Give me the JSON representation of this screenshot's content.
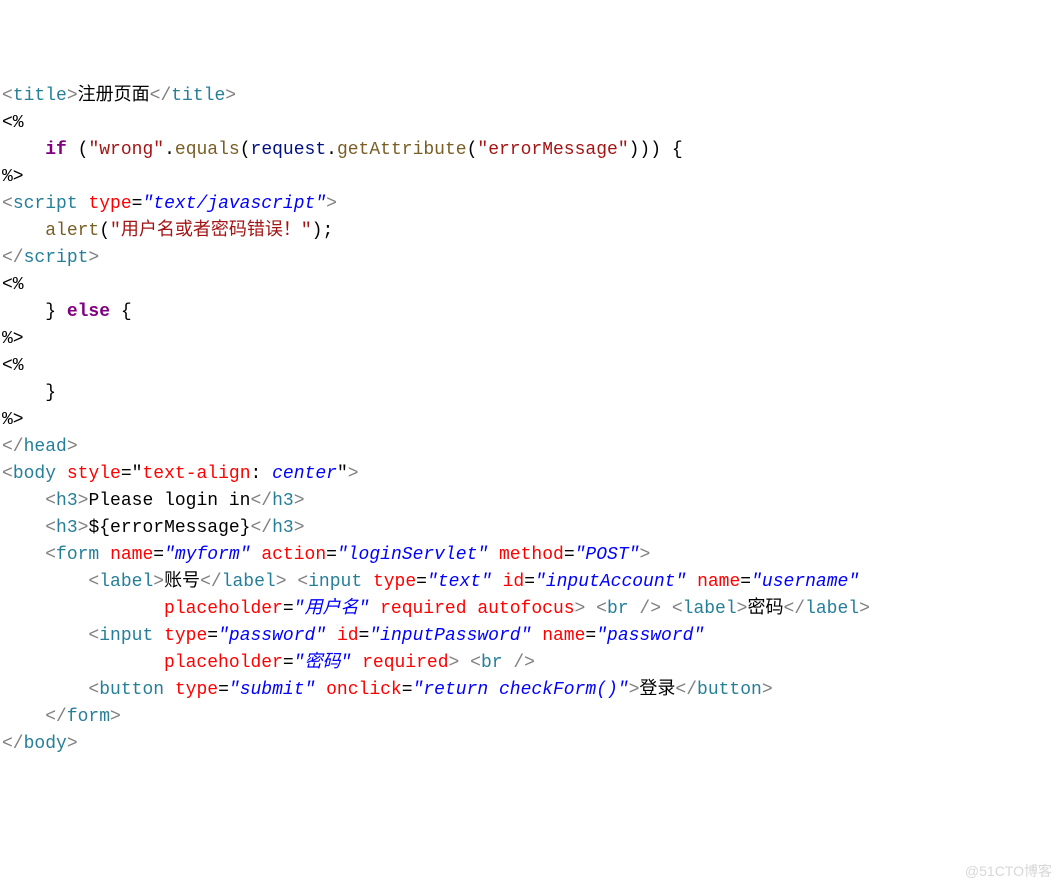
{
  "lines": {
    "l1": {
      "open": "<",
      "tag": "title",
      "gt": ">",
      "text": "注册页面",
      "lt2": "</",
      "tag2": "title",
      "gt2": ">"
    },
    "l2": {
      "open": "<%"
    },
    "l3": {
      "indent": "    ",
      "kw": "if",
      "sp": " ",
      "p": "(",
      "s": "\"wrong\"",
      "dot": ".",
      "m": "equals",
      "op": "(",
      "v": "request",
      "dot2": ".",
      "m2": "getAttribute",
      "op2": "(",
      "s2": "\"errorMessage\"",
      "cp": "))) {"
    },
    "l4": {
      "close": "%>"
    },
    "l5": {
      "lt": "<",
      "tag": "script",
      "sp": " ",
      "attr": "type",
      "eq": "=",
      "val": "\"text/javascript\"",
      "gt": ">"
    },
    "l6": {
      "indent": "    ",
      "fn": "alert",
      "p": "(",
      "s": "\"用户名或者密码错误！\"",
      "cp": ");"
    },
    "l7": {
      "lt": "</",
      "tag": "script",
      "gt": ">"
    },
    "l8": {
      "open": "<%"
    },
    "l9": {
      "indent": "    } ",
      "kw": "else",
      "rest": " {"
    },
    "l10": {
      "close": "%>"
    },
    "l11": {
      "open": "<%"
    },
    "l12": {
      "indent": "    }"
    },
    "l13": {
      "close": "%>"
    },
    "l14": {
      "lt": "</",
      "tag": "head",
      "gt": ">"
    },
    "l15": {
      "lt": "<",
      "tag": "body",
      "sp": " ",
      "attr": "style",
      "eq": "=",
      "q": "\"",
      "prop": "text-align",
      "col": ": ",
      "val": "center",
      "q2": "\"",
      "gt": ">"
    },
    "l16": {
      "indent": "    ",
      "lt": "<",
      "tag": "h3",
      "gt": ">",
      "text": "Please login in",
      "lt2": "</",
      "tag2": "h3",
      "gt2": ">"
    },
    "l17": {
      "indent": "    ",
      "lt": "<",
      "tag": "h3",
      "gt": ">",
      "text": "${errorMessage}",
      "lt2": "</",
      "tag2": "h3",
      "gt2": ">"
    },
    "l18": {
      "indent": "    ",
      "lt": "<",
      "tag": "form",
      "sp": " ",
      "a1": "name",
      "e1": "=",
      "v1": "\"myform\"",
      "sp2": " ",
      "a2": "action",
      "e2": "=",
      "v2": "\"loginServlet\"",
      "sp3": " ",
      "a3": "method",
      "e3": "=",
      "v3": "\"POST\"",
      "gt": ">"
    },
    "l19": {
      "indent": "        ",
      "lt": "<",
      "tag": "label",
      "gt": ">",
      "text": "账号",
      "lt2": "</",
      "tag2": "label",
      "gt2": ">",
      "sp": " ",
      "lt3": "<",
      "tag3": "input",
      "sp2": " ",
      "a1": "type",
      "e1": "=",
      "v1": "\"text\"",
      "sp3": " ",
      "a2": "id",
      "e2": "=",
      "v2": "\"inputAccount\"",
      "sp4": " ",
      "a3": "name",
      "e3": "=",
      "v3": "\"username\""
    },
    "l20": {
      "indent": "               ",
      "a1": "placeholder",
      "e1": "=",
      "v1": "\"用户名\"",
      "sp": " ",
      "a2": "required",
      "sp2": " ",
      "a3": "autofocus",
      "gt": ">",
      "sp3": " ",
      "lt": "<",
      "tag": "br",
      "sp4": " ",
      "sl": "/>",
      "sp5": " ",
      "lt2": "<",
      "tag2": "label",
      "gt2": ">",
      "text": "密码",
      "lt3": "</",
      "tag3": "label",
      "gt3": ">"
    },
    "l21": {
      "indent": "        ",
      "lt": "<",
      "tag": "input",
      "sp": " ",
      "a1": "type",
      "e1": "=",
      "v1": "\"password\"",
      "sp2": " ",
      "a2": "id",
      "e2": "=",
      "v2": "\"inputPassword\"",
      "sp3": " ",
      "a3": "name",
      "e3": "=",
      "v3": "\"password\""
    },
    "l22": {
      "indent": "               ",
      "a1": "placeholder",
      "e1": "=",
      "v1": "\"密码\"",
      "sp": " ",
      "a2": "required",
      "gt": ">",
      "sp2": " ",
      "lt": "<",
      "tag": "br",
      "sp3": " ",
      "sl": "/>"
    },
    "l23": {
      "indent": "        ",
      "lt": "<",
      "tag": "button",
      "sp": " ",
      "a1": "type",
      "e1": "=",
      "v1": "\"submit\"",
      "sp2": " ",
      "a2": "onclick",
      "e2": "=",
      "v2": "\"return checkForm()\"",
      "gt": ">",
      "text": "登录",
      "lt2": "</",
      "tag2": "button",
      "gt2": ">"
    },
    "l24": {
      "indent": "    ",
      "lt": "</",
      "tag": "form",
      "gt": ">"
    },
    "l25": {
      "lt": "</",
      "tag": "body",
      "gt": ">"
    }
  },
  "watermark": "@51CTO博客"
}
